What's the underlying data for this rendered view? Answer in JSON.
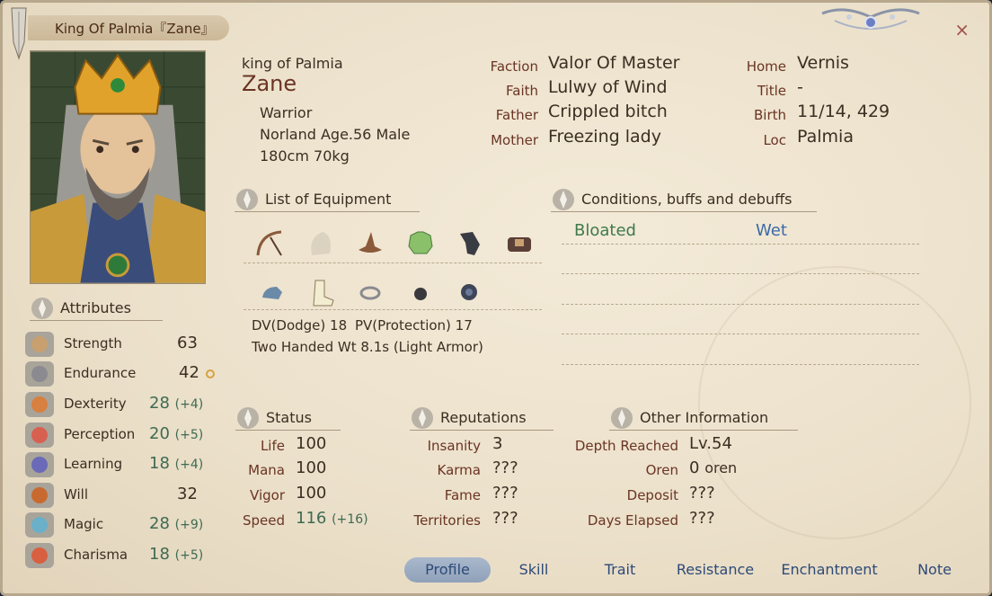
{
  "window": {
    "title": "King Of Palmia『Zane』",
    "close_label": "×"
  },
  "profile": {
    "alias": "king of Palmia",
    "name": "Zane",
    "class": "Warrior",
    "race_age_sex": "Norland Age.56 Male",
    "height_weight": "180cm 70kg"
  },
  "details_mid": [
    {
      "label": "Faction",
      "value": "Valor Of Master"
    },
    {
      "label": "Faith",
      "value": "Lulwy of Wind"
    },
    {
      "label": "Father",
      "value": "Crippled bitch"
    },
    {
      "label": "Mother",
      "value": "Freezing lady"
    }
  ],
  "details_right": [
    {
      "label": "Home",
      "value": "Vernis"
    },
    {
      "label": "Title",
      "value": "-"
    },
    {
      "label": "Birth",
      "value": "11/14, 429"
    },
    {
      "label": "Loc",
      "value": "Palmia"
    }
  ],
  "equipment": {
    "header": "List of Equipment",
    "row1_icons": [
      "bow-icon",
      "cloak-icon",
      "hat-icon",
      "armor-icon",
      "gauntlet-icon",
      "belt-icon"
    ],
    "row2_icons": [
      "helmet-icon",
      "boots-icon",
      "ring-icon",
      "amulet-icon",
      "shield-icon"
    ],
    "dv": "DV(Dodge) 18",
    "pv": "PV(Protection) 17",
    "style": "Two Handed Wt 8.1s (Light Armor)"
  },
  "conditions": {
    "header": "Conditions, buffs and debuffs",
    "items": [
      {
        "name": "Bloated",
        "color": "#3e7a4a"
      },
      {
        "name": "Wet",
        "color": "#3a6aa8"
      }
    ]
  },
  "attributes": {
    "header": "Attributes",
    "items": [
      {
        "name": "Strength",
        "value": "63",
        "bonus": "",
        "icon": "crossed-swords-icon"
      },
      {
        "name": "Endurance",
        "value": "42",
        "bonus": "",
        "icon": "helm-face-icon"
      },
      {
        "name": "Dexterity",
        "value": "28",
        "bonus": "(+4)",
        "icon": "amulet-dex-icon"
      },
      {
        "name": "Perception",
        "value": "20",
        "bonus": "(+5)",
        "icon": "crosshair-icon"
      },
      {
        "name": "Learning",
        "value": "18",
        "bonus": "(+4)",
        "icon": "book-icon"
      },
      {
        "name": "Will",
        "value": "32",
        "bonus": "",
        "icon": "shield-will-icon"
      },
      {
        "name": "Magic",
        "value": "28",
        "bonus": "(+9)",
        "icon": "magic-rune-icon"
      },
      {
        "name": "Charisma",
        "value": "18",
        "bonus": "(+5)",
        "icon": "ribbon-icon"
      }
    ]
  },
  "status": {
    "header": "Status",
    "items": [
      {
        "label": "Life",
        "value": "100",
        "bonus": ""
      },
      {
        "label": "Mana",
        "value": "100",
        "bonus": ""
      },
      {
        "label": "Vigor",
        "value": "100",
        "bonus": ""
      },
      {
        "label": "Speed",
        "value": "116",
        "bonus": "(+16)"
      }
    ]
  },
  "reputations": {
    "header": "Reputations",
    "items": [
      {
        "label": "Insanity",
        "value": "3"
      },
      {
        "label": "Karma",
        "value": "???"
      },
      {
        "label": "Fame",
        "value": "???"
      },
      {
        "label": "Territories",
        "value": "???"
      }
    ]
  },
  "other": {
    "header": "Other Information",
    "items": [
      {
        "label": "Depth Reached",
        "value": "Lv.54"
      },
      {
        "label": "Oren",
        "value": "0",
        "unit": "oren"
      },
      {
        "label": "Deposit",
        "value": "???"
      },
      {
        "label": "Days Elapsed",
        "value": "???"
      }
    ]
  },
  "tabs": [
    "Profile",
    "Skill",
    "Trait",
    "Resistance",
    "Enchantment",
    "Note"
  ],
  "active_tab": "Profile"
}
